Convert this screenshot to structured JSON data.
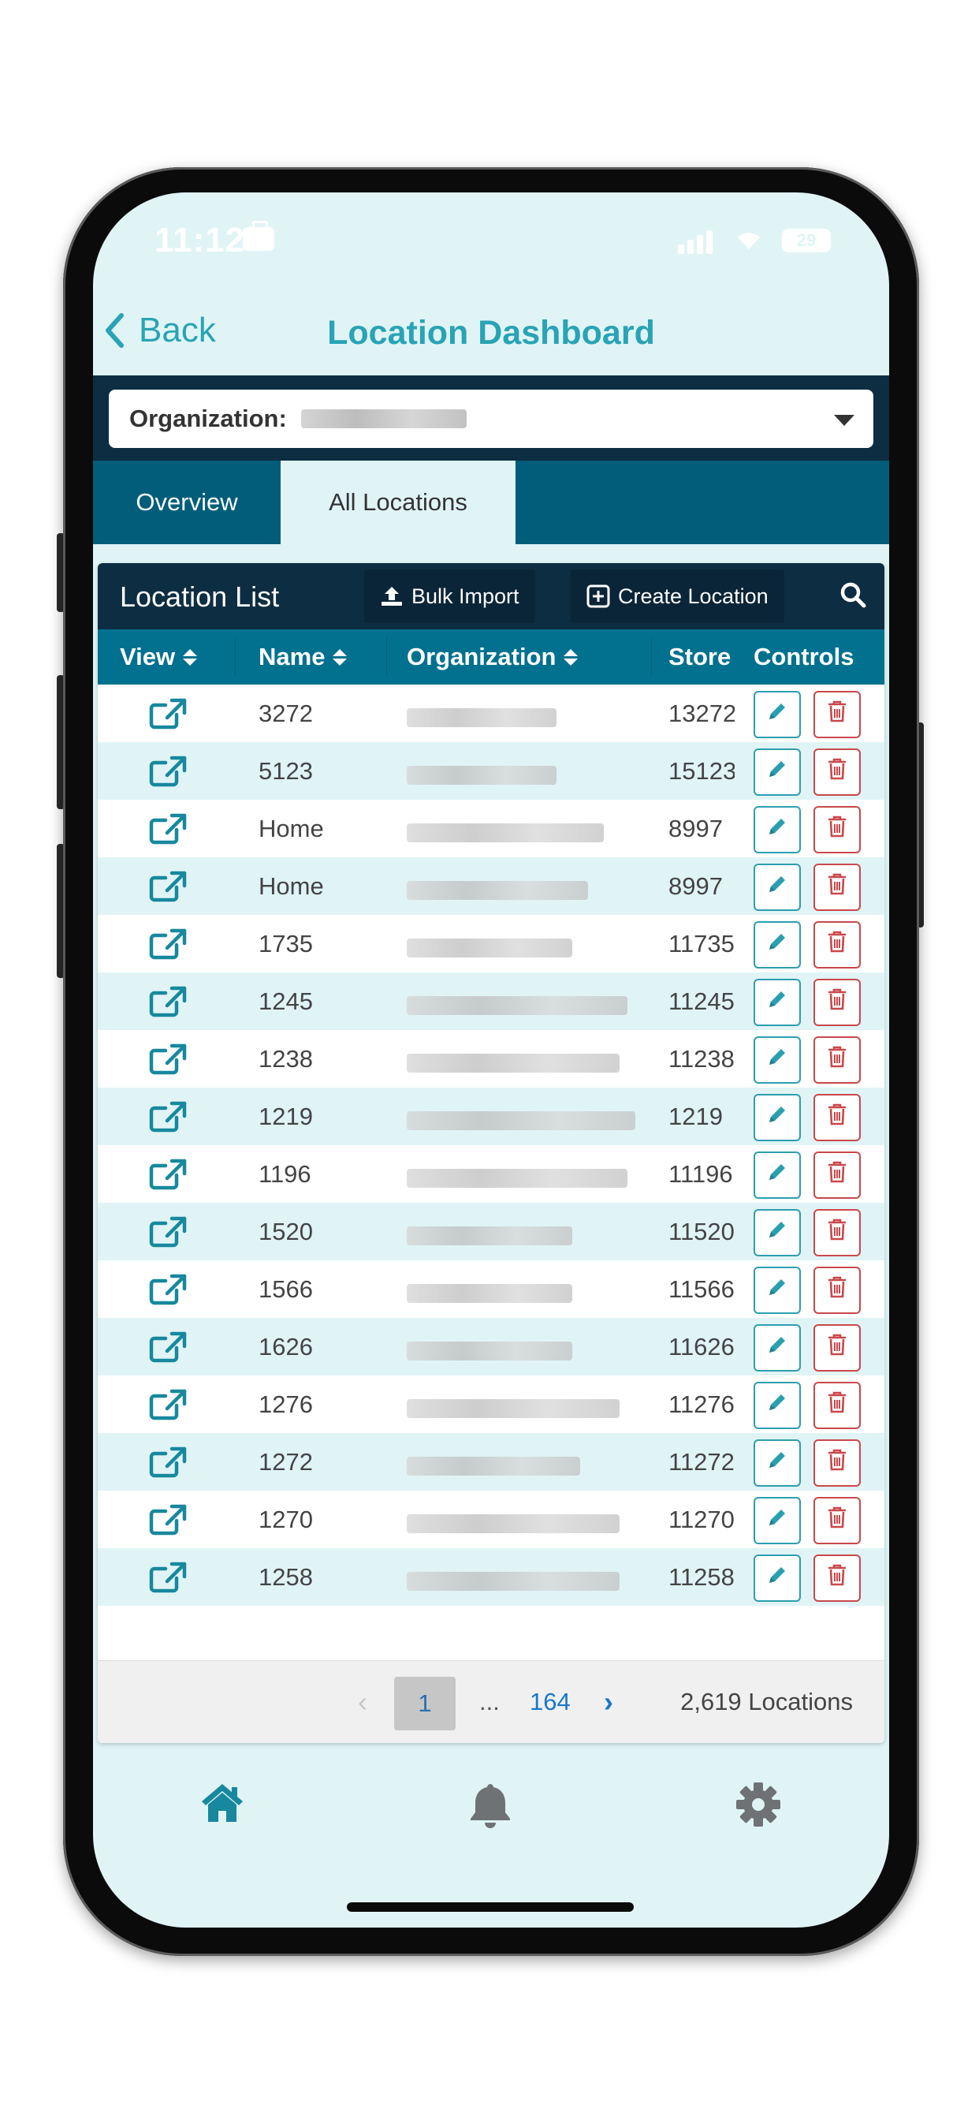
{
  "status": {
    "time": "11:12",
    "battery": "29"
  },
  "nav": {
    "back_label": "Back",
    "title": "Location Dashboard"
  },
  "org_filter": {
    "label": "Organization:"
  },
  "tabs": [
    {
      "label": "Overview"
    },
    {
      "label": "All Locations"
    }
  ],
  "panel": {
    "title": "Location List",
    "bulk_import_label": "Bulk Import",
    "create_location_label": "Create Location"
  },
  "table": {
    "columns": [
      "View",
      "Name",
      "Organization",
      "Store",
      "Controls"
    ],
    "rows": [
      {
        "name": "3272",
        "store": "13272"
      },
      {
        "name": "5123",
        "store": "15123"
      },
      {
        "name": "Home",
        "store": "8997"
      },
      {
        "name": "Home",
        "store": "8997"
      },
      {
        "name": "1735",
        "store": "11735"
      },
      {
        "name": "1245",
        "store": "11245"
      },
      {
        "name": "1238",
        "store": "11238"
      },
      {
        "name": "1219",
        "store": "1219"
      },
      {
        "name": "1196",
        "store": "11196"
      },
      {
        "name": "1520",
        "store": "11520"
      },
      {
        "name": "1566",
        "store": "11566"
      },
      {
        "name": "1626",
        "store": "11626"
      },
      {
        "name": "1276",
        "store": "11276"
      },
      {
        "name": "1272",
        "store": "11272"
      },
      {
        "name": "1270",
        "store": "11270"
      },
      {
        "name": "1258",
        "store": "11258"
      }
    ]
  },
  "pagination": {
    "current": "1",
    "ellipsis": "...",
    "last": "164",
    "total": "2,619 Locations"
  },
  "colors": {
    "accent": "#29a3b5",
    "header_dark": "#0d2d42",
    "table_header": "#01718f",
    "tab_bar": "#015d79",
    "delete": "#c9484b"
  },
  "icons": [
    "external-link-icon",
    "sort-icon",
    "edit-pencil-icon",
    "trash-icon",
    "upload-icon",
    "plus-square-icon",
    "search-icon",
    "home-icon",
    "bell-icon",
    "gear-icon"
  ]
}
